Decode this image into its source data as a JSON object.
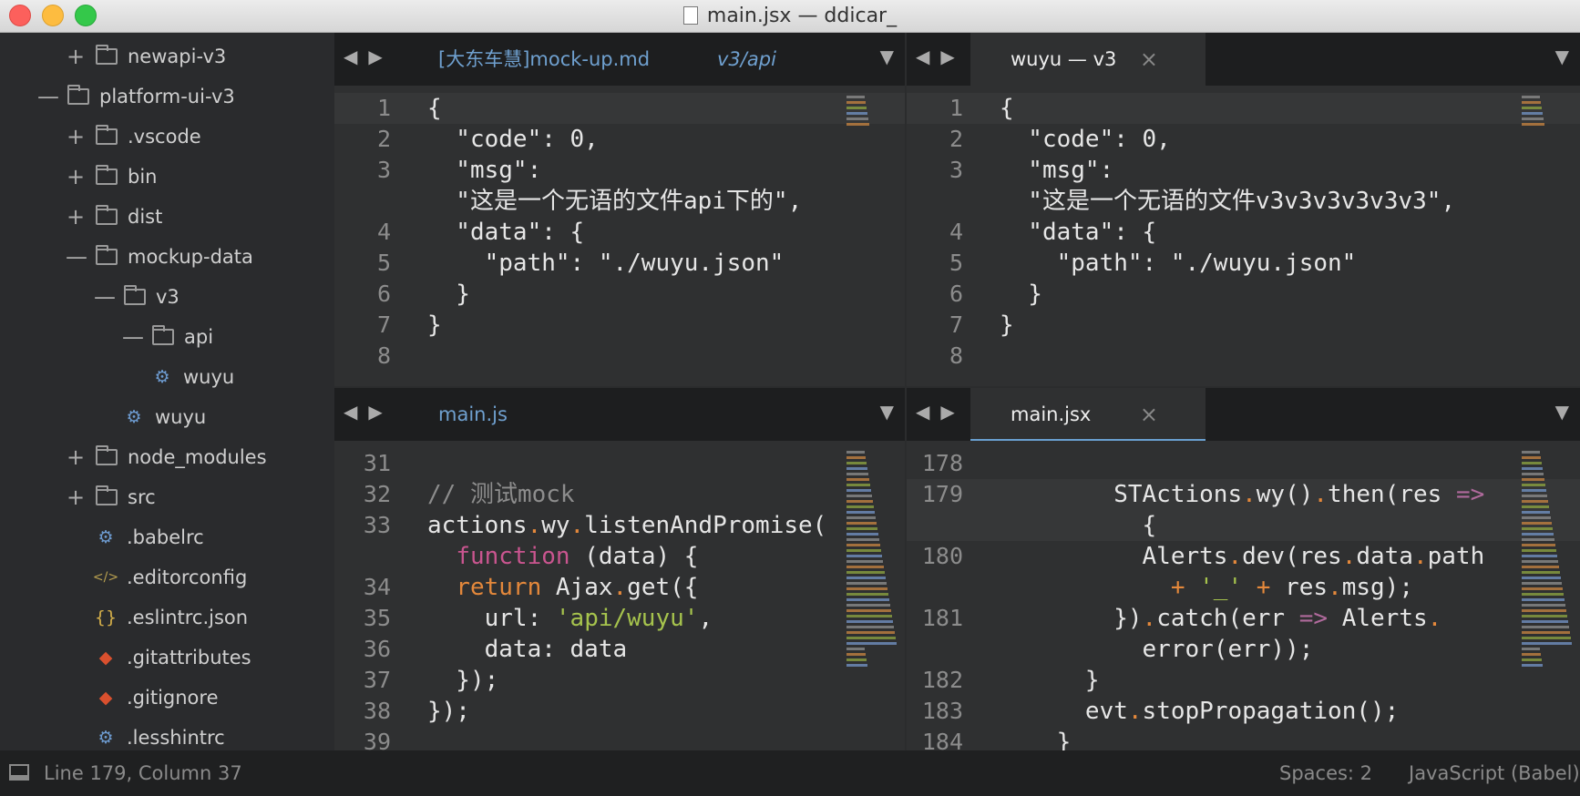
{
  "window": {
    "title": "main.jsx — ddicar_"
  },
  "sidebar": {
    "items": [
      {
        "label": "newapi-v3",
        "type": "folder",
        "state": "collapsed",
        "depth": 1
      },
      {
        "label": "platform-ui-v3",
        "type": "folder",
        "state": "expanded",
        "depth": 0
      },
      {
        "label": ".vscode",
        "type": "folder",
        "state": "collapsed",
        "depth": 1
      },
      {
        "label": "bin",
        "type": "folder",
        "state": "collapsed",
        "depth": 1
      },
      {
        "label": "dist",
        "type": "folder",
        "state": "collapsed",
        "depth": 1
      },
      {
        "label": "mockup-data",
        "type": "folder",
        "state": "expanded",
        "depth": 1
      },
      {
        "label": "v3",
        "type": "folder",
        "state": "expanded",
        "depth": 2
      },
      {
        "label": "api",
        "type": "folder",
        "state": "expanded",
        "depth": 3
      },
      {
        "label": "wuyu",
        "type": "gear",
        "depth": 4
      },
      {
        "label": "wuyu",
        "type": "gear",
        "depth": 3
      },
      {
        "label": "node_modules",
        "type": "folder",
        "state": "collapsed",
        "depth": 1
      },
      {
        "label": "src",
        "type": "folder",
        "state": "collapsed",
        "depth": 1
      },
      {
        "label": ".babelrc",
        "type": "gear",
        "depth": 2
      },
      {
        "label": ".editorconfig",
        "type": "code",
        "depth": 2
      },
      {
        "label": ".eslintrc.json",
        "type": "braces",
        "depth": 2
      },
      {
        "label": ".gitattributes",
        "type": "git",
        "depth": 2
      },
      {
        "label": ".gitignore",
        "type": "git",
        "depth": 2
      },
      {
        "label": ".lesshintrc",
        "type": "gear",
        "depth": 2
      }
    ]
  },
  "panes": [
    {
      "tabs": [
        {
          "label": "[大东车慧]mock-up.md",
          "active": false
        },
        {
          "label": "v3/api",
          "active": false,
          "italic": true
        }
      ],
      "rows": [
        {
          "n": "1",
          "hl": true,
          "t": [
            [
              "{",
              "s"
            ]
          ]
        },
        {
          "n": "2",
          "t": [
            [
              "  \"code\": 0,",
              "s"
            ]
          ]
        },
        {
          "n": "3",
          "t": [
            [
              "  \"msg\":",
              "s"
            ]
          ]
        },
        {
          "n": "",
          "t": [
            [
              "  \"这是一个无语的文件api下的\",",
              "s"
            ]
          ]
        },
        {
          "n": "4",
          "t": [
            [
              "  \"data\": {",
              "s"
            ]
          ]
        },
        {
          "n": "5",
          "t": [
            [
              "    \"path\": \"./wuyu.json\"",
              "s"
            ]
          ]
        },
        {
          "n": "6",
          "t": [
            [
              "  }",
              "s"
            ]
          ]
        },
        {
          "n": "7",
          "t": [
            [
              "}",
              "s"
            ]
          ]
        },
        {
          "n": "8",
          "t": []
        }
      ]
    },
    {
      "tabs": [
        {
          "label": "wuyu — v3",
          "active": true,
          "close": true
        }
      ],
      "rows": [
        {
          "n": "1",
          "hl": true,
          "t": [
            [
              "{",
              "s"
            ]
          ]
        },
        {
          "n": "2",
          "t": [
            [
              "  \"code\": 0,",
              "s"
            ]
          ]
        },
        {
          "n": "3",
          "t": [
            [
              "  \"msg\":",
              "s"
            ]
          ]
        },
        {
          "n": "",
          "t": [
            [
              "  \"这是一个无语的文件v3v3v3v3v3v3\",",
              "s"
            ]
          ]
        },
        {
          "n": "4",
          "t": [
            [
              "  \"data\": {",
              "s"
            ]
          ]
        },
        {
          "n": "5",
          "t": [
            [
              "    \"path\": \"./wuyu.json\"",
              "s"
            ]
          ]
        },
        {
          "n": "6",
          "t": [
            [
              "  }",
              "s"
            ]
          ]
        },
        {
          "n": "7",
          "t": [
            [
              "}",
              "s"
            ]
          ]
        },
        {
          "n": "8",
          "t": []
        }
      ]
    },
    {
      "tabs": [
        {
          "label": "main.js",
          "active": false
        }
      ],
      "rows": [
        {
          "n": "31",
          "t": []
        },
        {
          "n": "32",
          "t": [
            [
              "// 测试mock",
              "cm"
            ]
          ]
        },
        {
          "n": "33",
          "t": [
            [
              "actions",
              "s"
            ],
            [
              ".",
              "dot"
            ],
            [
              "wy",
              "s"
            ],
            [
              ".",
              "dot"
            ],
            [
              "listenAndPromise(",
              "s"
            ]
          ]
        },
        {
          "n": "",
          "t": [
            [
              "  ",
              "s"
            ],
            [
              "function",
              "kw"
            ],
            [
              " (data) {",
              "s"
            ]
          ]
        },
        {
          "n": "34",
          "t": [
            [
              "  ",
              "s"
            ],
            [
              "return",
              "ret"
            ],
            [
              " Ajax",
              "s"
            ],
            [
              ".",
              "dot"
            ],
            [
              "get({",
              "s"
            ]
          ]
        },
        {
          "n": "35",
          "t": [
            [
              "    url: ",
              "s"
            ],
            [
              "'api/wuyu'",
              "str"
            ],
            [
              ",",
              "s"
            ]
          ]
        },
        {
          "n": "36",
          "t": [
            [
              "    data: data",
              "s"
            ]
          ]
        },
        {
          "n": "37",
          "t": [
            [
              "  });",
              "s"
            ]
          ]
        },
        {
          "n": "38",
          "t": [
            [
              "});",
              "s"
            ]
          ]
        },
        {
          "n": "39",
          "t": []
        }
      ]
    },
    {
      "tabs": [
        {
          "label": "main.jsx",
          "active": true,
          "focus": true,
          "close": true
        }
      ],
      "rows": [
        {
          "n": "178",
          "t": []
        },
        {
          "n": "179",
          "hl": true,
          "t": [
            [
              "        STActions",
              "s"
            ],
            [
              ".",
              "dot"
            ],
            [
              "wy()",
              "s"
            ],
            [
              ".",
              "dot"
            ],
            [
              "then(res ",
              "s"
            ],
            [
              "=>",
              "arr"
            ]
          ]
        },
        {
          "n": "",
          "hl": true,
          "t": [
            [
              "          {",
              "s"
            ]
          ]
        },
        {
          "n": "180",
          "t": [
            [
              "          Alerts",
              "s"
            ],
            [
              ".",
              "dot"
            ],
            [
              "dev(res",
              "s"
            ],
            [
              ".",
              "dot"
            ],
            [
              "data",
              "s"
            ],
            [
              ".",
              "dot"
            ],
            [
              "path",
              "s"
            ]
          ]
        },
        {
          "n": "",
          "t": [
            [
              "            ",
              "s"
            ],
            [
              "+",
              "dot"
            ],
            [
              " ",
              "s"
            ],
            [
              "'_'",
              "str"
            ],
            [
              " ",
              "s"
            ],
            [
              "+",
              "dot"
            ],
            [
              " res",
              "s"
            ],
            [
              ".",
              "dot"
            ],
            [
              "msg);",
              "s"
            ]
          ]
        },
        {
          "n": "181",
          "t": [
            [
              "        })",
              "s"
            ],
            [
              ".",
              "dot"
            ],
            [
              "catch(err ",
              "s"
            ],
            [
              "=>",
              "arr"
            ],
            [
              " Alerts",
              "s"
            ],
            [
              ".",
              "dot"
            ]
          ]
        },
        {
          "n": "",
          "t": [
            [
              "          error(err));",
              "s"
            ]
          ]
        },
        {
          "n": "182",
          "t": [
            [
              "      }",
              "s"
            ]
          ]
        },
        {
          "n": "183",
          "t": [
            [
              "      evt",
              "s"
            ],
            [
              ".",
              "dot"
            ],
            [
              "stopPropagation();",
              "s"
            ]
          ]
        },
        {
          "n": "184",
          "t": [
            [
              "    }",
              "s"
            ]
          ]
        }
      ]
    }
  ],
  "statusbar": {
    "position": "Line 179, Column 37",
    "indent": "Spaces: 2",
    "syntax": "JavaScript (Babel)"
  }
}
